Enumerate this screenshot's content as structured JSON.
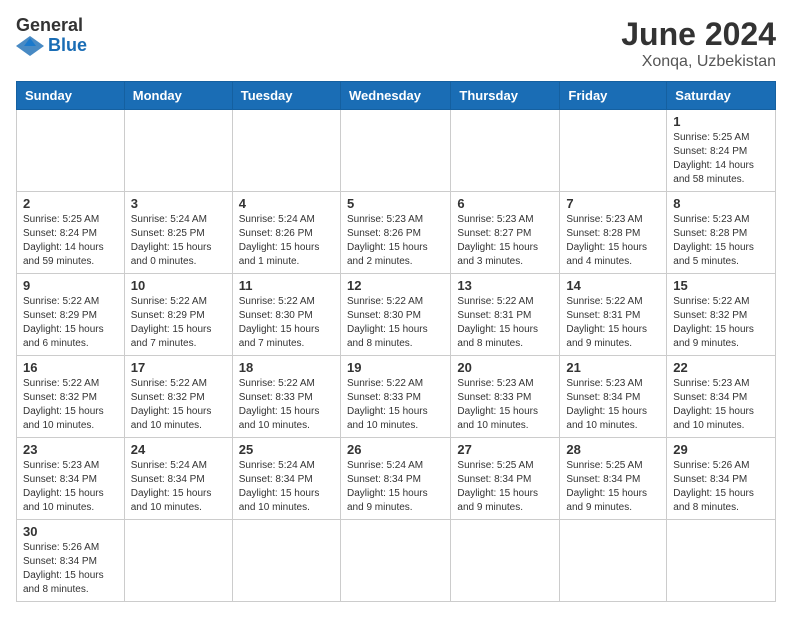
{
  "header": {
    "logo_line1": "General",
    "logo_line2": "Blue",
    "title": "June 2024",
    "subtitle": "Xonqa, Uzbekistan"
  },
  "days_of_week": [
    "Sunday",
    "Monday",
    "Tuesday",
    "Wednesday",
    "Thursday",
    "Friday",
    "Saturday"
  ],
  "weeks": [
    [
      {
        "day": "",
        "info": ""
      },
      {
        "day": "",
        "info": ""
      },
      {
        "day": "",
        "info": ""
      },
      {
        "day": "",
        "info": ""
      },
      {
        "day": "",
        "info": ""
      },
      {
        "day": "",
        "info": ""
      },
      {
        "day": "1",
        "info": "Sunrise: 5:25 AM\nSunset: 8:24 PM\nDaylight: 14 hours and 58 minutes."
      }
    ],
    [
      {
        "day": "2",
        "info": "Sunrise: 5:25 AM\nSunset: 8:24 PM\nDaylight: 14 hours and 59 minutes."
      },
      {
        "day": "3",
        "info": "Sunrise: 5:24 AM\nSunset: 8:25 PM\nDaylight: 15 hours and 0 minutes."
      },
      {
        "day": "4",
        "info": "Sunrise: 5:24 AM\nSunset: 8:26 PM\nDaylight: 15 hours and 1 minute."
      },
      {
        "day": "5",
        "info": "Sunrise: 5:23 AM\nSunset: 8:26 PM\nDaylight: 15 hours and 2 minutes."
      },
      {
        "day": "6",
        "info": "Sunrise: 5:23 AM\nSunset: 8:27 PM\nDaylight: 15 hours and 3 minutes."
      },
      {
        "day": "7",
        "info": "Sunrise: 5:23 AM\nSunset: 8:28 PM\nDaylight: 15 hours and 4 minutes."
      },
      {
        "day": "8",
        "info": "Sunrise: 5:23 AM\nSunset: 8:28 PM\nDaylight: 15 hours and 5 minutes."
      }
    ],
    [
      {
        "day": "9",
        "info": "Sunrise: 5:22 AM\nSunset: 8:29 PM\nDaylight: 15 hours and 6 minutes."
      },
      {
        "day": "10",
        "info": "Sunrise: 5:22 AM\nSunset: 8:29 PM\nDaylight: 15 hours and 7 minutes."
      },
      {
        "day": "11",
        "info": "Sunrise: 5:22 AM\nSunset: 8:30 PM\nDaylight: 15 hours and 7 minutes."
      },
      {
        "day": "12",
        "info": "Sunrise: 5:22 AM\nSunset: 8:30 PM\nDaylight: 15 hours and 8 minutes."
      },
      {
        "day": "13",
        "info": "Sunrise: 5:22 AM\nSunset: 8:31 PM\nDaylight: 15 hours and 8 minutes."
      },
      {
        "day": "14",
        "info": "Sunrise: 5:22 AM\nSunset: 8:31 PM\nDaylight: 15 hours and 9 minutes."
      },
      {
        "day": "15",
        "info": "Sunrise: 5:22 AM\nSunset: 8:32 PM\nDaylight: 15 hours and 9 minutes."
      }
    ],
    [
      {
        "day": "16",
        "info": "Sunrise: 5:22 AM\nSunset: 8:32 PM\nDaylight: 15 hours and 10 minutes."
      },
      {
        "day": "17",
        "info": "Sunrise: 5:22 AM\nSunset: 8:32 PM\nDaylight: 15 hours and 10 minutes."
      },
      {
        "day": "18",
        "info": "Sunrise: 5:22 AM\nSunset: 8:33 PM\nDaylight: 15 hours and 10 minutes."
      },
      {
        "day": "19",
        "info": "Sunrise: 5:22 AM\nSunset: 8:33 PM\nDaylight: 15 hours and 10 minutes."
      },
      {
        "day": "20",
        "info": "Sunrise: 5:23 AM\nSunset: 8:33 PM\nDaylight: 15 hours and 10 minutes."
      },
      {
        "day": "21",
        "info": "Sunrise: 5:23 AM\nSunset: 8:34 PM\nDaylight: 15 hours and 10 minutes."
      },
      {
        "day": "22",
        "info": "Sunrise: 5:23 AM\nSunset: 8:34 PM\nDaylight: 15 hours and 10 minutes."
      }
    ],
    [
      {
        "day": "23",
        "info": "Sunrise: 5:23 AM\nSunset: 8:34 PM\nDaylight: 15 hours and 10 minutes."
      },
      {
        "day": "24",
        "info": "Sunrise: 5:24 AM\nSunset: 8:34 PM\nDaylight: 15 hours and 10 minutes."
      },
      {
        "day": "25",
        "info": "Sunrise: 5:24 AM\nSunset: 8:34 PM\nDaylight: 15 hours and 10 minutes."
      },
      {
        "day": "26",
        "info": "Sunrise: 5:24 AM\nSunset: 8:34 PM\nDaylight: 15 hours and 9 minutes."
      },
      {
        "day": "27",
        "info": "Sunrise: 5:25 AM\nSunset: 8:34 PM\nDaylight: 15 hours and 9 minutes."
      },
      {
        "day": "28",
        "info": "Sunrise: 5:25 AM\nSunset: 8:34 PM\nDaylight: 15 hours and 9 minutes."
      },
      {
        "day": "29",
        "info": "Sunrise: 5:26 AM\nSunset: 8:34 PM\nDaylight: 15 hours and 8 minutes."
      }
    ],
    [
      {
        "day": "30",
        "info": "Sunrise: 5:26 AM\nSunset: 8:34 PM\nDaylight: 15 hours and 8 minutes."
      },
      {
        "day": "",
        "info": ""
      },
      {
        "day": "",
        "info": ""
      },
      {
        "day": "",
        "info": ""
      },
      {
        "day": "",
        "info": ""
      },
      {
        "day": "",
        "info": ""
      },
      {
        "day": "",
        "info": ""
      }
    ]
  ]
}
